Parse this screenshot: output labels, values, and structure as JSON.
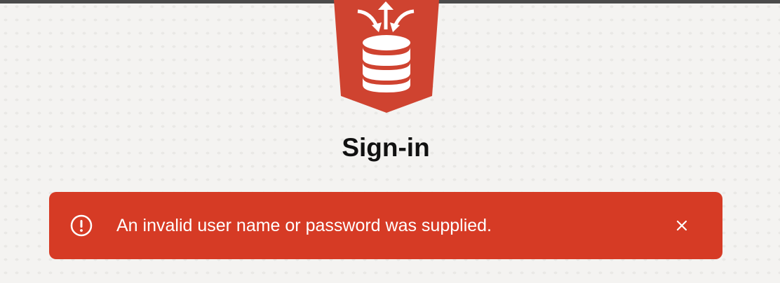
{
  "colors": {
    "background": "#f4f3f1",
    "logo_red": "#cf4330",
    "alert_red": "#d63b25",
    "title_text": "#111111",
    "alert_text": "#ffffff"
  },
  "logo": {
    "icon": "database-icon"
  },
  "page": {
    "title": "Sign-in"
  },
  "alert": {
    "type": "error",
    "icon": "exclamation-circle-icon",
    "message": "An invalid user name or password was supplied.",
    "close_icon": "close-icon"
  }
}
